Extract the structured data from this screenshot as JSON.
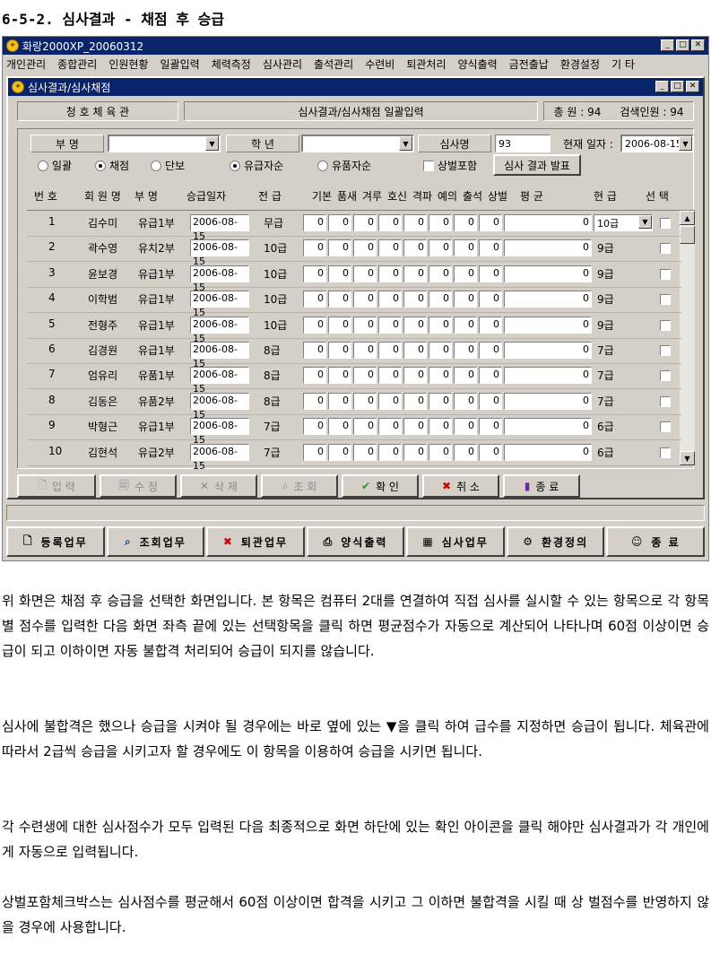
{
  "heading": "6-5-2. 심사결과 - 채점 후 승급",
  "app": {
    "title": "화랑2000XP_20060312",
    "menu": [
      "개인관리",
      "종합관리",
      "인원현황",
      "일괄입력",
      "체력측정",
      "심사관리",
      "출석관리",
      "수련비",
      "퇴관처리",
      "양식출력",
      "금전출납",
      "환경설정",
      "기 타"
    ]
  },
  "inner": {
    "title": "심사결과/심사채점",
    "gym_name": "청 호 체 육 관",
    "screen_name": "심사결과/심사채점 일괄입력",
    "total_label": "총 원 : 94",
    "search_label": "검색인원 : 94"
  },
  "filters": {
    "dept_label": "부 명",
    "grade_label": "학 년",
    "exam_label": "심사명",
    "exam_value": "93",
    "date_label": "현재 일자 :",
    "date_value": "2006-08-15",
    "radio_batch": "일괄",
    "radio_score": "채점",
    "radio_single": "단보",
    "radio_paid": "유급자순",
    "radio_belt": "유품자순",
    "award_label": "상벌포함",
    "publish_button": "심사 결과 발표"
  },
  "columns": [
    "번 호",
    "회 원 명",
    "부 명",
    "승급일자",
    "전 급",
    "기본",
    "품새",
    "겨루",
    "호신",
    "격파",
    "예의",
    "출석",
    "상벌",
    "평 균",
    "현 급",
    "선 택"
  ],
  "rows": [
    {
      "no": "1",
      "name": "김수미",
      "dept": "유급1부",
      "date": "2006-08-15",
      "prev": "무급",
      "avg": "0",
      "cur": "10급"
    },
    {
      "no": "2",
      "name": "곽수영",
      "dept": "유치2부",
      "date": "2006-08-15",
      "prev": "10급",
      "avg": "0",
      "cur": "9급"
    },
    {
      "no": "3",
      "name": "윤보경",
      "dept": "유급1부",
      "date": "2006-08-15",
      "prev": "10급",
      "avg": "0",
      "cur": "9급"
    },
    {
      "no": "4",
      "name": "이학범",
      "dept": "유급1부",
      "date": "2006-08-15",
      "prev": "10급",
      "avg": "0",
      "cur": "9급"
    },
    {
      "no": "5",
      "name": "전형주",
      "dept": "유급1부",
      "date": "2006-08-15",
      "prev": "10급",
      "avg": "0",
      "cur": "9급"
    },
    {
      "no": "6",
      "name": "김경원",
      "dept": "유급1부",
      "date": "2006-08-15",
      "prev": "8급",
      "avg": "0",
      "cur": "7급"
    },
    {
      "no": "7",
      "name": "엄유리",
      "dept": "유품1부",
      "date": "2006-08-15",
      "prev": "8급",
      "avg": "0",
      "cur": "7급"
    },
    {
      "no": "8",
      "name": "김동은",
      "dept": "유품2부",
      "date": "2006-08-15",
      "prev": "8급",
      "avg": "0",
      "cur": "7급"
    },
    {
      "no": "9",
      "name": "박형근",
      "dept": "유급1부",
      "date": "2006-08-15",
      "prev": "7급",
      "avg": "0",
      "cur": "6급"
    },
    {
      "no": "10",
      "name": "김현석",
      "dept": "유급2부",
      "date": "2006-08-15",
      "prev": "7급",
      "avg": "0",
      "cur": "6급"
    }
  ],
  "score_value": "0",
  "toolbar": {
    "input": "입 력",
    "edit": "수 정",
    "delete": "삭 제",
    "search": "조 회",
    "confirm": "확 인",
    "cancel": "취 소",
    "exit": "종 료"
  },
  "bottom": {
    "register": "등록업무",
    "lookup": "조회업무",
    "leave": "퇴관업무",
    "print": "양식출력",
    "exam": "심사업무",
    "env": "환경정의",
    "quit": "종 료"
  },
  "paragraphs": [
    "위 화면은 채점 후 승급을 선택한 화면입니다. 본 항목은 컴퓨터 2대를 연결하여 직접 심사를 실시할 수 있는 항목으로 각 항목별 점수를 입력한 다음 화면 좌측 끝에 있는 선택항목을 클릭 하면 평균점수가 자동으로 계산되어 나타나며 60점 이상이면 승급이 되고 이하이면 자동 불합격 처리되어 승급이 되지를 않습니다.",
    "심사에 불합격은 했으나 승급을 시켜야 될 경우에는 바로 옆에 있는 ▼을 클릭 하여 급수를 지정하면 승급이 됩니다. 체육관에 따라서 2급씩 승급을 시키고자 할 경우에도 이 항목을 이용하여 승급을 시키면 됩니다.",
    "각 수련생에 대한 심사점수가 모두 입력된 다음 최종적으로 화면 하단에 있는 확인 아이콘을 클릭 해야만 심사결과가 각 개인에게 자동으로 입력됩니다.",
    "상벌포함체크박스는 심사점수를 평균해서 60점 이상이면 합격을 시키고 그 이하면 불합격을 시킬 때 상 벌점수를 반영하지 않을 경우에 사용합니다."
  ]
}
